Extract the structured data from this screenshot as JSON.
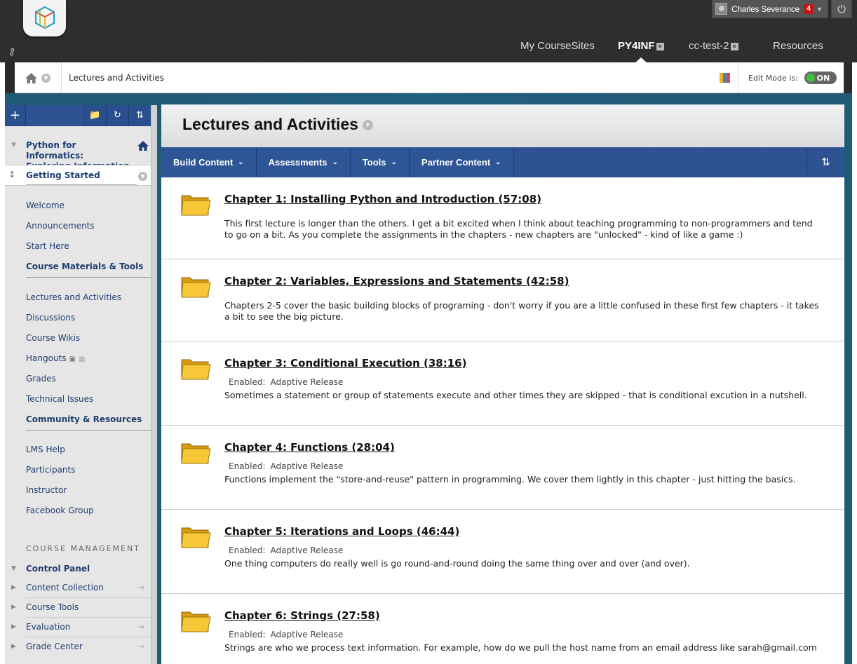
{
  "header": {
    "user_name": "Charles Severance",
    "notification_count": "4",
    "nav": [
      {
        "label": "My CourseSites"
      },
      {
        "label": "PY4INF",
        "closable": true,
        "active": true
      },
      {
        "label": "cc-test-2",
        "closable": true
      },
      {
        "label": "Resources"
      }
    ],
    "close_glyph": "×"
  },
  "breadcrumb": {
    "current": "Lectures and Activities",
    "edit_mode_label": "Edit Mode is:",
    "edit_mode_state": "ON"
  },
  "sidebar": {
    "course_title_line1": "Python for Informatics:",
    "course_title_line2": "Exploring Information",
    "current_section": "Getting Started",
    "items": [
      {
        "label": "Welcome"
      },
      {
        "label": "Announcements"
      },
      {
        "label": "Start Here"
      },
      {
        "label": "Course Materials & Tools",
        "heading": true
      },
      {
        "label": "Lectures and Activities"
      },
      {
        "label": "Discussions"
      },
      {
        "label": "Course Wikis"
      },
      {
        "label": "Hangouts"
      },
      {
        "label": "Grades"
      },
      {
        "label": "Technical Issues"
      },
      {
        "label": "Community & Resources",
        "heading": true
      },
      {
        "label": "LMS Help"
      },
      {
        "label": "Participants"
      },
      {
        "label": "Instructor"
      },
      {
        "label": "Facebook Group"
      }
    ],
    "management_heading": "COURSE MANAGEMENT",
    "control_panel": "Control Panel",
    "control_items": [
      {
        "label": "Content Collection"
      },
      {
        "label": "Course Tools"
      },
      {
        "label": "Evaluation"
      },
      {
        "label": "Grade Center"
      }
    ]
  },
  "content": {
    "title": "Lectures and Activities",
    "actions": [
      {
        "label": "Build Content"
      },
      {
        "label": "Assessments"
      },
      {
        "label": "Tools"
      },
      {
        "label": "Partner Content"
      }
    ],
    "release_label": "Enabled:",
    "release_value": "Adaptive Release",
    "items": [
      {
        "title": "Chapter 1: Installing Python and Introduction (57:08)",
        "release": false,
        "description": "This first lecture is longer than the others.  I get a bit excited when I think about teaching programming to non-programmers and tend to go on a bit.  As you complete the assignments in the chapters - new chapters are \"unlocked\" - kind of like a game :)"
      },
      {
        "title": "Chapter 2: Variables, Expressions and Statements (42:58)",
        "release": false,
        "description": "Chapters 2-5 cover the basic building blocks of programing - don't worry if you are a little confused in these first few chapters - it takes a bit to see the big picture."
      },
      {
        "title": "Chapter 3: Conditional Execution (38:16)",
        "release": true,
        "description": "Sometimes a statement or group of statements execute and other times they are skipped - that is conditional excution in a nutshell."
      },
      {
        "title": "Chapter 4: Functions (28:04)",
        "release": true,
        "description": "Functions implement the \"store-and-reuse\" pattern in programming.   We cover them lightly in this chapter - just hitting the basics."
      },
      {
        "title": "Chapter 5: Iterations and Loops (46:44)",
        "release": true,
        "description": "One thing computers do really well is go round-and-round doing the same thing over and over (and over)."
      },
      {
        "title": "Chapter 6: Strings (27:58)",
        "release": true,
        "description": "Strings are who we process text information.   For example, how do we pull the host name from an email address like sarah@gmail.com"
      }
    ]
  }
}
